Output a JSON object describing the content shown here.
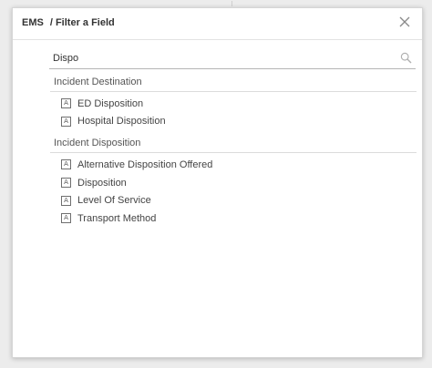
{
  "header": {
    "app_name": "EMS",
    "breadcrumb": "/ Filter a Field"
  },
  "search": {
    "value": "Dispo",
    "placeholder": ""
  },
  "groups": [
    {
      "label": "Incident Destination",
      "items": [
        {
          "label": "ED Disposition",
          "type_icon": "A"
        },
        {
          "label": "Hospital Disposition",
          "type_icon": "A"
        }
      ]
    },
    {
      "label": "Incident Disposition",
      "items": [
        {
          "label": "Alternative Disposition Offered",
          "type_icon": "A"
        },
        {
          "label": "Disposition",
          "type_icon": "A"
        },
        {
          "label": "Level Of Service",
          "type_icon": "A"
        },
        {
          "label": "Transport Method",
          "type_icon": "A"
        }
      ]
    }
  ],
  "icons": {
    "close": "close-icon",
    "search": "search-icon",
    "field_type": "text-field-type-icon"
  }
}
